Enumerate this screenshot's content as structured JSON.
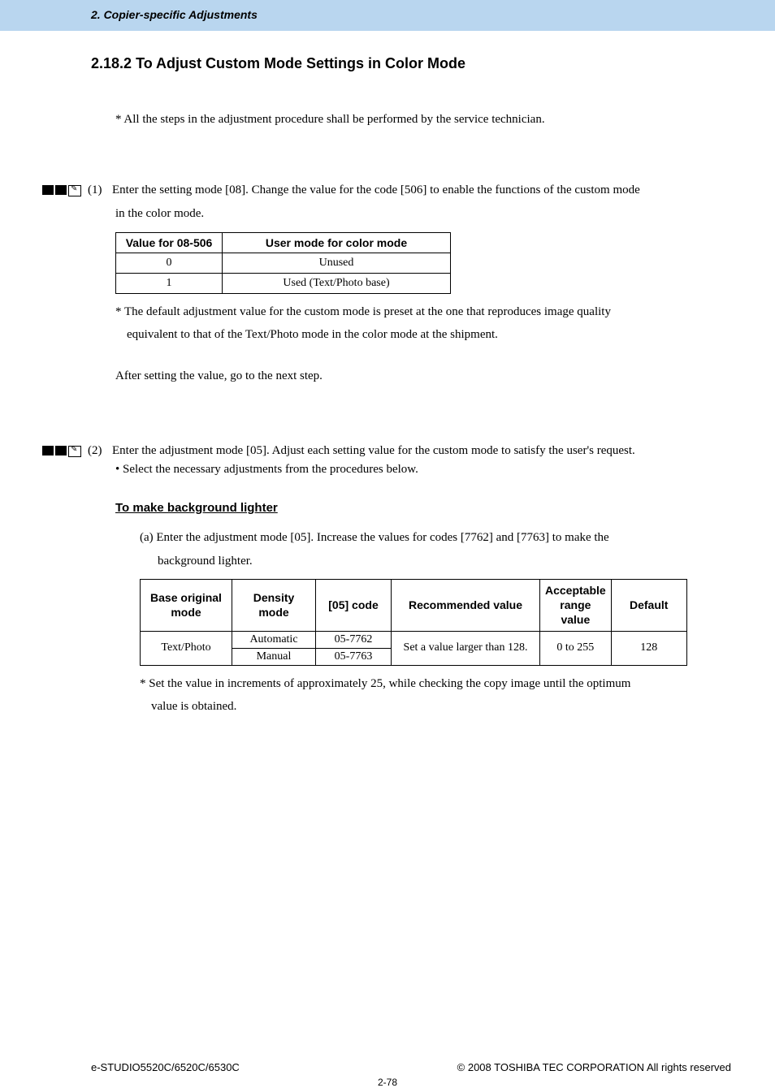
{
  "header": {
    "breadcrumb": "2. Copier-specific Adjustments"
  },
  "section": {
    "number": "2.18.2",
    "title": "To Adjust Custom Mode Settings in Color Mode"
  },
  "intro_note": "* All the steps in the adjustment procedure shall be performed by the service technician.",
  "step1": {
    "num": "(1)",
    "text": "Enter the setting mode [08]. Change the value for the code [506] to enable the functions of the custom mode",
    "cont": "in the color mode."
  },
  "table1": {
    "headers": [
      "Value for 08-506",
      "User mode for color mode"
    ],
    "rows": [
      [
        "0",
        "Unused"
      ],
      [
        "1",
        "Used (Text/Photo base)"
      ]
    ]
  },
  "table1_note": {
    "line1": "* The default adjustment value for the custom mode is preset at the one that reproduces image quality",
    "line2": "equivalent to that of the Text/Photo mode in the color mode at the shipment."
  },
  "after_setting": "After setting the value, go to the next step.",
  "step2": {
    "num": "(2)",
    "text": "Enter the adjustment mode [05]. Adjust each setting value for the custom mode to satisfy the user's request.",
    "bullet": "• Select the necessary adjustments from the procedures below."
  },
  "subheading": "To make background lighter",
  "substep": {
    "line1": "(a) Enter the adjustment mode [05]. Increase the values for codes [7762] and [7763] to make the",
    "line2": "background lighter."
  },
  "table2": {
    "headers": [
      "Base original mode",
      "Density mode",
      "[05] code",
      "Recommended value",
      "Acceptable range value",
      "Default"
    ],
    "merged_col1": "Text/Photo",
    "row1": [
      "Automatic",
      "05-7762"
    ],
    "row2": [
      "Manual",
      "05-7763"
    ],
    "merged_rec": "Set a value larger than 128.",
    "merged_range": "0 to 255",
    "merged_default": "128"
  },
  "table2_note": {
    "line1": "* Set the value in increments of approximately 25, while checking the copy image until the optimum",
    "line2": "value is obtained."
  },
  "footer": {
    "left": "e-STUDIO5520C/6520C/6530C",
    "right": "© 2008 TOSHIBA TEC CORPORATION All rights reserved",
    "page": "2-78"
  }
}
